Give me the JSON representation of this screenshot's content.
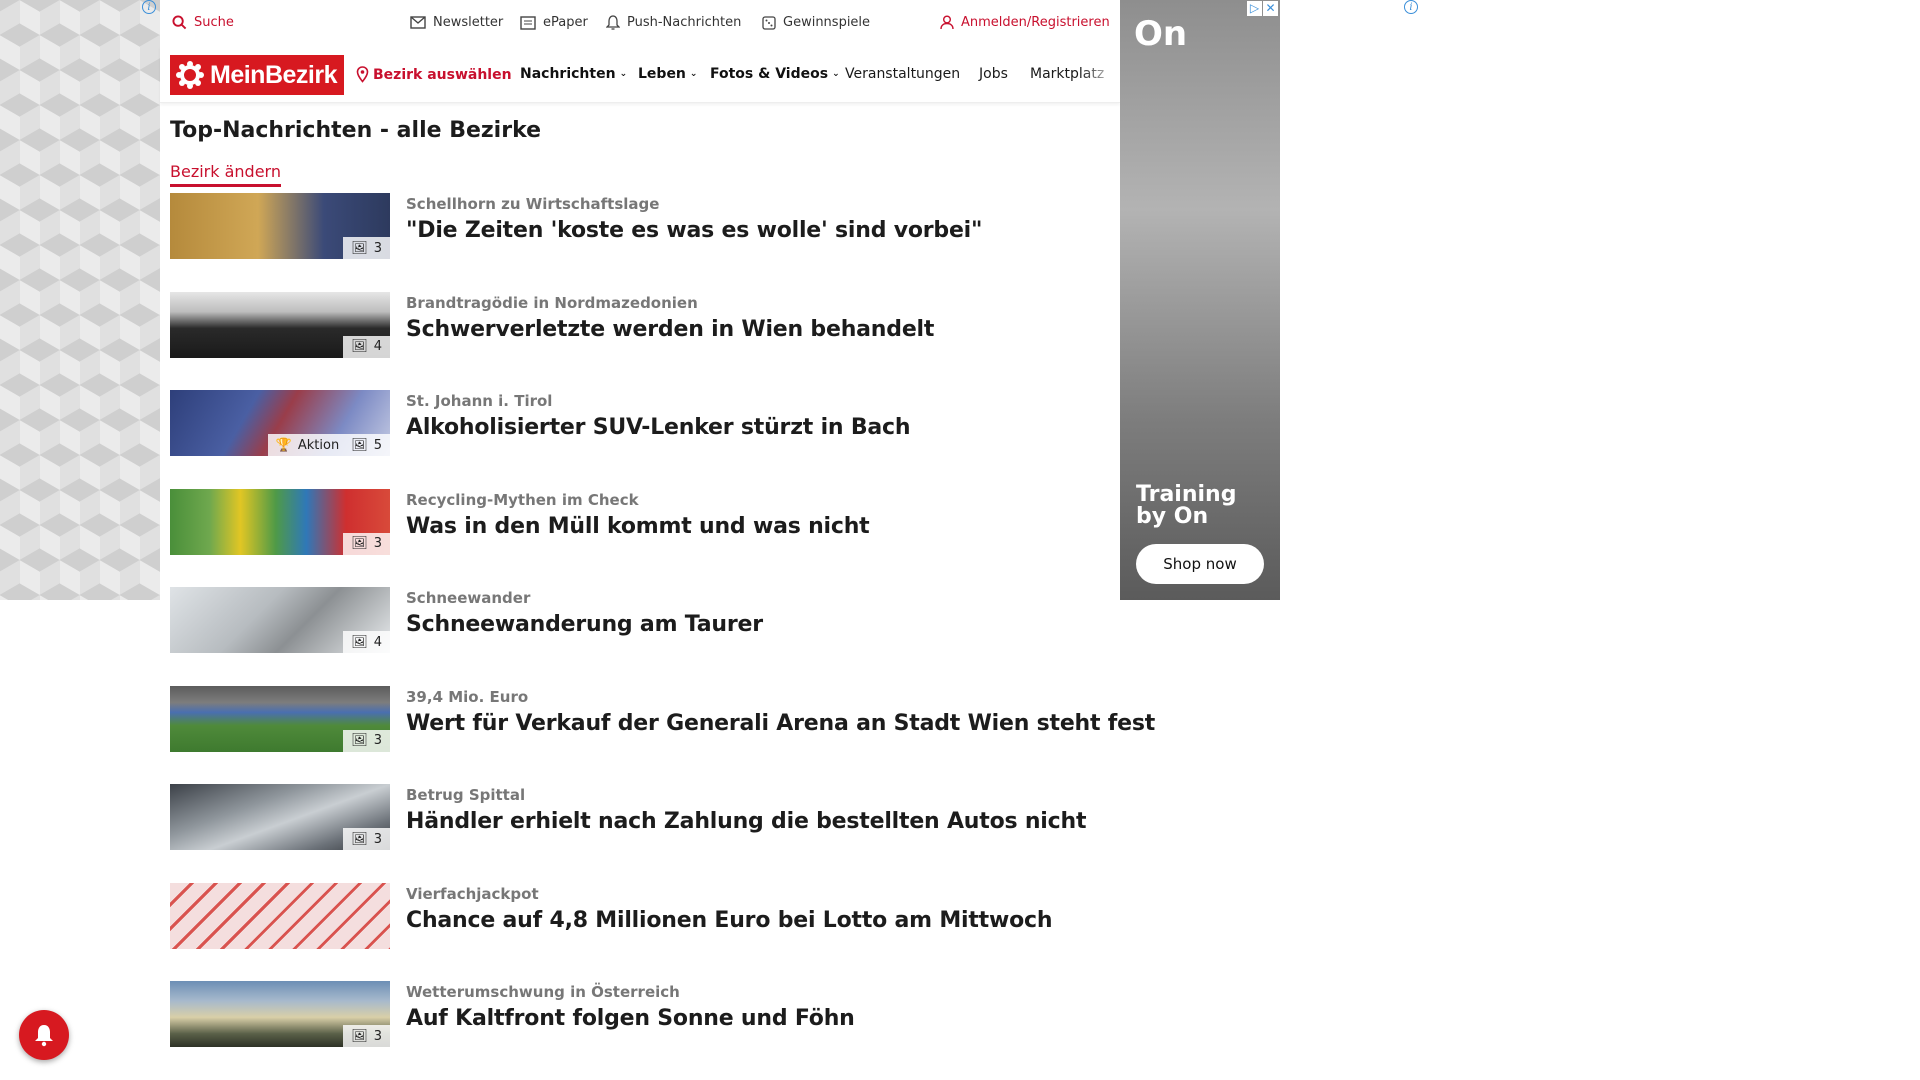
{
  "topbar": {
    "search": "Suche",
    "newsletter": "Newsletter",
    "epaper": "ePaper",
    "push": "Push-Nachrichten",
    "gewinnspiele": "Gewinnspiele",
    "login": "Anmelden/Registrieren"
  },
  "nav": {
    "logo": "MeinBezirk",
    "bezirk": "Bezirk auswählen",
    "items": [
      "Nachrichten",
      "Leben",
      "Fotos & Videos",
      "Veranstaltungen",
      "Jobs",
      "Marktplatz"
    ]
  },
  "page": {
    "title": "Top-Nachrichten - alle Bezirke",
    "change_link": "Bezirk ändern"
  },
  "articles": [
    {
      "kicker": "Schellhorn zu Wirtschaftslage",
      "headline": "\"Die Zeiten 'koste es was es wolle' sind vorbei\"",
      "images": "3",
      "aktion": ""
    },
    {
      "kicker": "Brandtragödie in Nordmazedonien",
      "headline": "Schwerverletzte werden in Wien behandelt",
      "images": "4",
      "aktion": ""
    },
    {
      "kicker": "St. Johann i. Tirol",
      "headline": "Alkoholisierter SUV-Lenker stürzt in Bach",
      "images": "5",
      "aktion": "Aktion"
    },
    {
      "kicker": "Recycling-Mythen im Check",
      "headline": "Was in den Müll kommt und was nicht",
      "images": "3",
      "aktion": ""
    },
    {
      "kicker": "Schneewander",
      "headline": "Schneewanderung am Taurer",
      "images": "4",
      "aktion": ""
    },
    {
      "kicker": "39,4 Mio. Euro",
      "headline": "Wert für Verkauf der Generali Arena an Stadt Wien steht fest",
      "images": "3",
      "aktion": ""
    },
    {
      "kicker": "Betrug Spittal",
      "headline": "Händler erhielt nach Zahlung die bestellten Autos nicht",
      "images": "3",
      "aktion": ""
    },
    {
      "kicker": "Vierfachjackpot",
      "headline": "Chance auf 4,8 Millionen Euro bei Lotto am Mittwoch",
      "images": "",
      "aktion": ""
    },
    {
      "kicker": "Wetterumschwung in Österreich",
      "headline": "Auf Kaltfront folgen Sonne und Föhn",
      "images": "3",
      "aktion": ""
    }
  ],
  "ad": {
    "brand": "On",
    "text_line1": "Training",
    "text_line2": "by On",
    "button": "Shop now"
  },
  "colors": {
    "brand_red": "#d71920",
    "link_red": "#c8102e"
  }
}
